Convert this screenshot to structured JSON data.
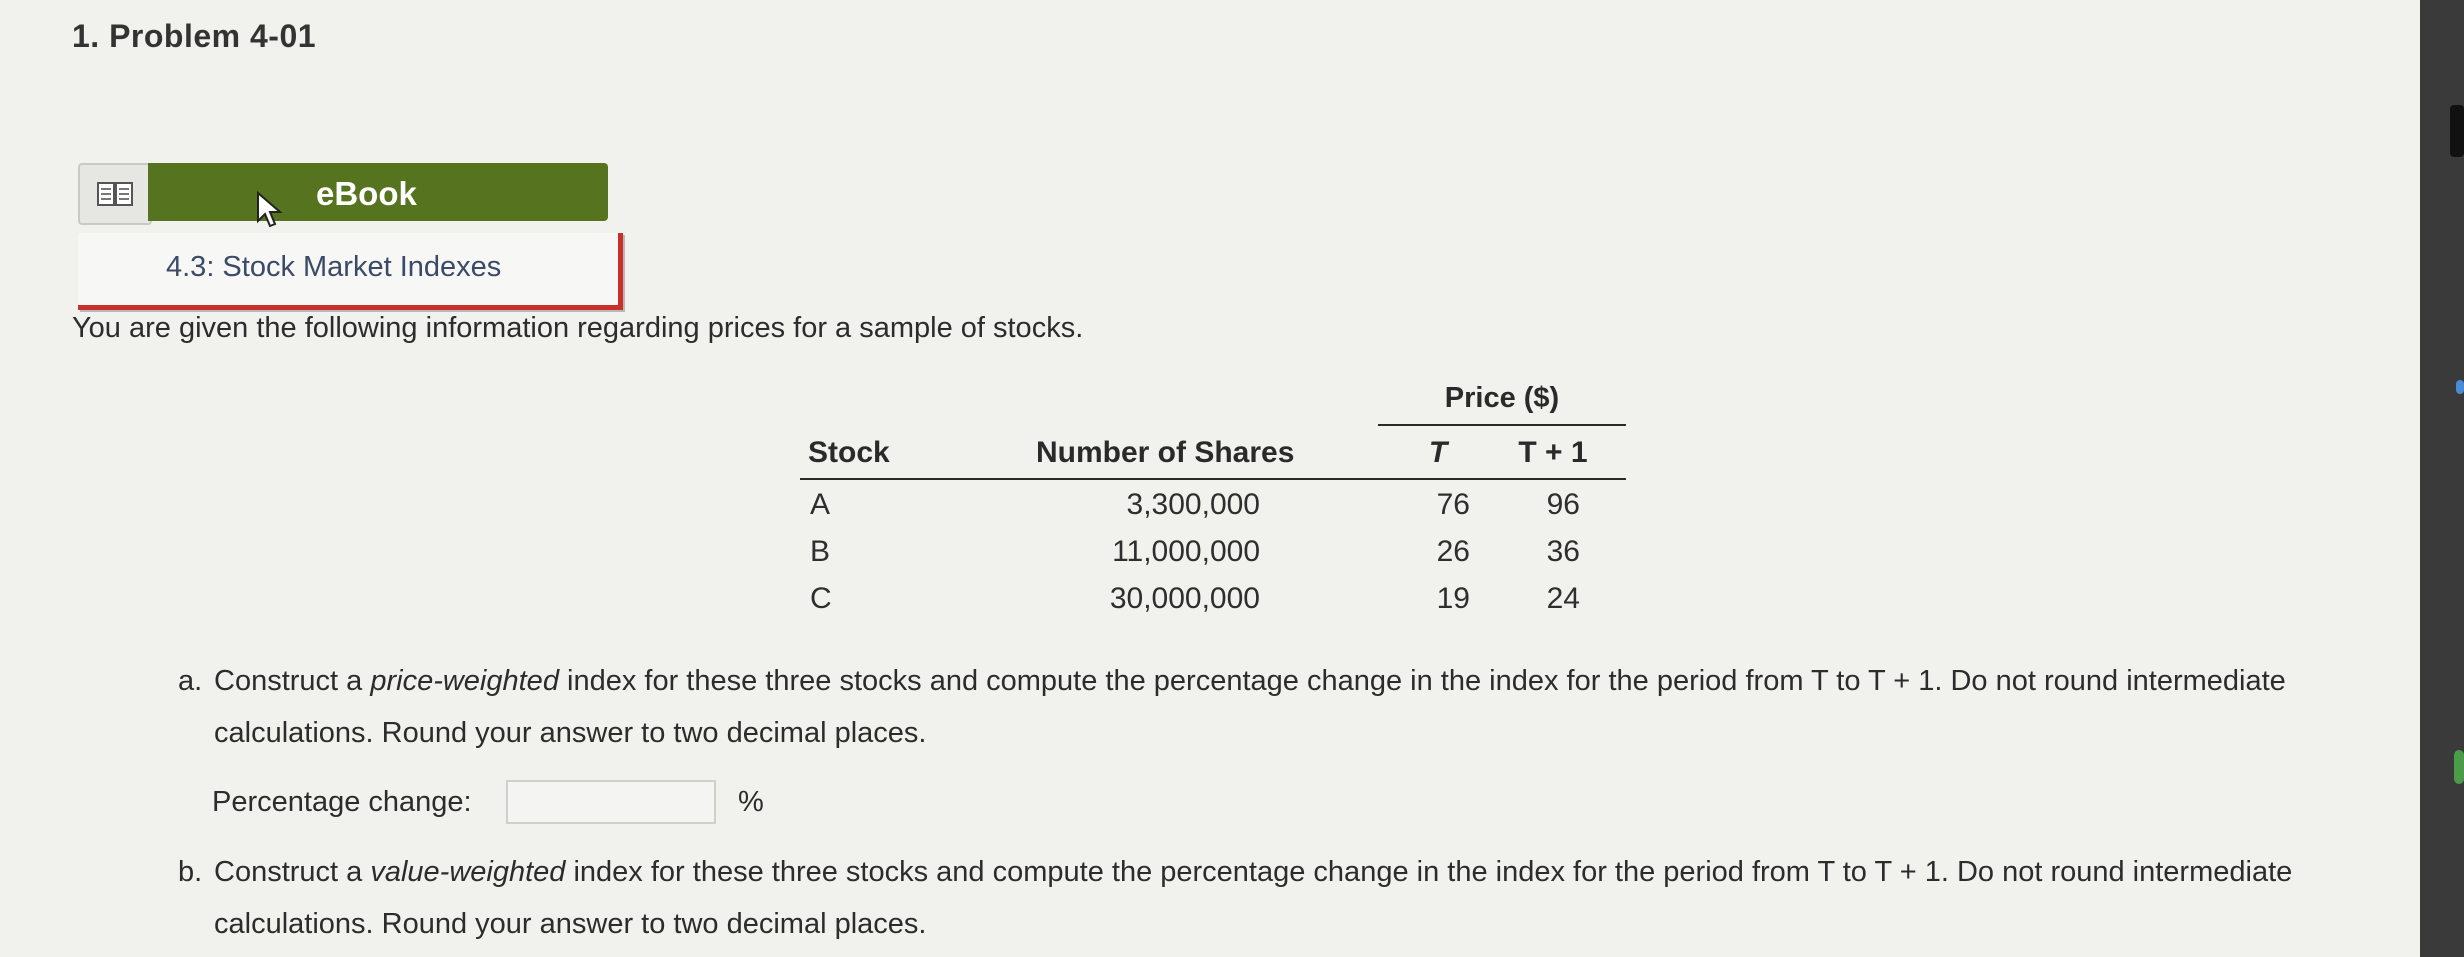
{
  "problem": {
    "title": "1.  Problem 4-01"
  },
  "ebook": {
    "label": "eBook",
    "section": "4.3: Stock Market Indexes"
  },
  "intro": "You are given the following information regarding prices for a sample of stocks.",
  "table": {
    "price_header": "Price ($)",
    "columns": [
      "Stock",
      "Number of Shares",
      "T",
      "T + 1"
    ],
    "rows": [
      {
        "stock": "A",
        "shares": "3,300,000",
        "t": "76",
        "t1": "96"
      },
      {
        "stock": "B",
        "shares": "11,000,000",
        "t": "26",
        "t1": "36"
      },
      {
        "stock": "C",
        "shares": "30,000,000",
        "t": "19",
        "t1": "24"
      }
    ]
  },
  "question_a": {
    "letter": "a.",
    "pre": "Construct a ",
    "emph": "price-weighted",
    "post": " index for these three stocks and compute the percentage change in the index for the period from T to T + 1. Do not round intermediate calculations. Round your answer to two decimal places."
  },
  "answer_a": {
    "label": "Percentage change:",
    "value": "",
    "unit": "%"
  },
  "question_b": {
    "letter": "b.",
    "pre": "Construct a ",
    "emph": "value-weighted",
    "post": " index for these three stocks and compute the percentage change in the index for the period from T to T + 1. Do not round intermediate calculations. Round your answer to two decimal places."
  },
  "colors": {
    "ebook_bar": "#56731f",
    "section_accent": "#c9302c",
    "section_text": "#3b4a66"
  },
  "icons": {
    "ebook": "open-book-icon",
    "cursor": "mouse-pointer-icon"
  }
}
